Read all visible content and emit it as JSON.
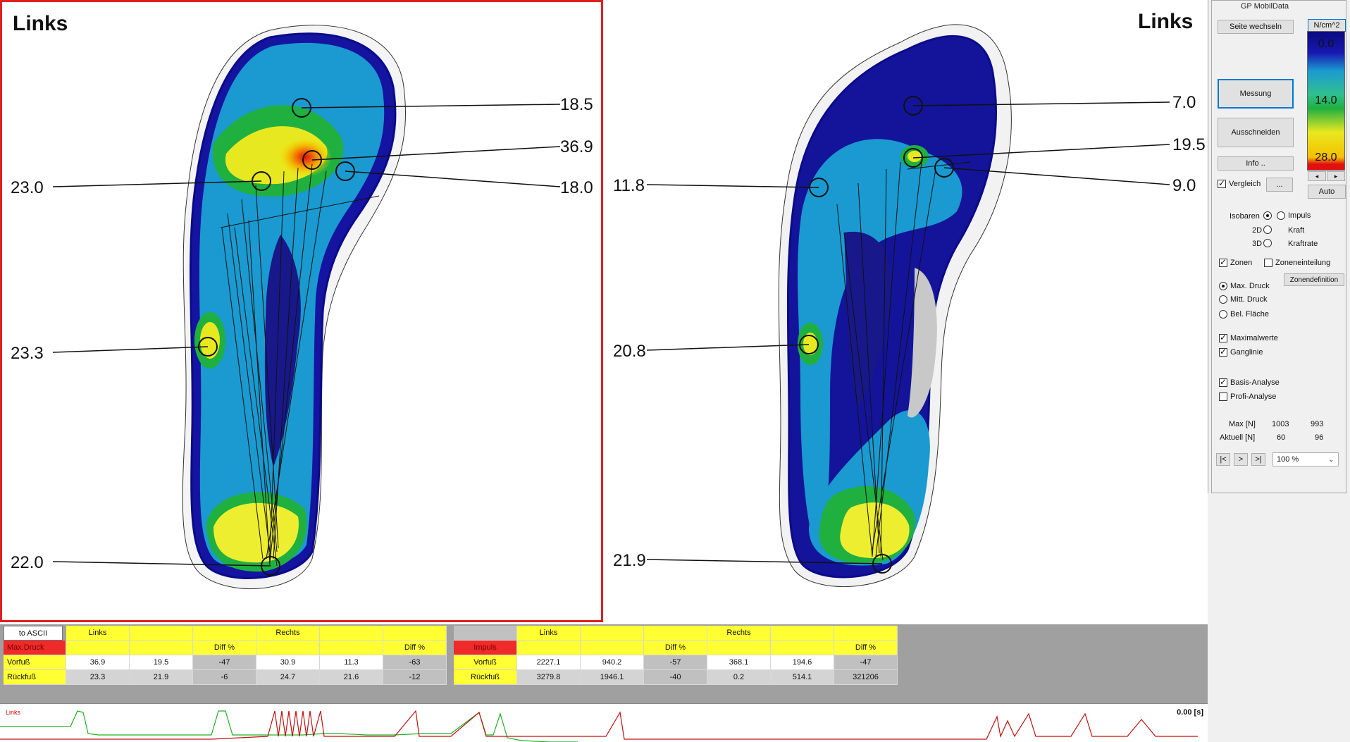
{
  "app_title": "GP MobilData",
  "panels": {
    "left": {
      "title": "Links",
      "labels": {
        "toe": "18.5",
        "meta1": "36.9",
        "meta5": "18.0",
        "medial": "23.0",
        "mid": "23.3",
        "heel": "22.0"
      }
    },
    "right": {
      "title": "Links",
      "labels": {
        "toe": "7.0",
        "meta1": "19.5",
        "meta5": "9.0",
        "medial": "11.8",
        "mid": "20.8",
        "heel": "21.9"
      }
    }
  },
  "controls": {
    "seite_wechseln": "Seite wechseln",
    "unit": "N/cm^2",
    "messung": "Messung",
    "ausschneiden": "Ausschneiden",
    "info": "Info ..",
    "vergleich": "Vergleich",
    "more": "...",
    "auto": "Auto",
    "scale_left_arrow": "◂",
    "scale_right_arrow": "▸",
    "scale": {
      "top": "0.0",
      "mid": "14.0",
      "bottom": "28.0"
    },
    "isobaren": "Isobaren",
    "impuls": "Impuls",
    "d2": "2D",
    "kraft": "Kraft",
    "d3": "3D",
    "kraftrate": "Kraftrate",
    "zonen": "Zonen",
    "zoneneinteilung": "Zoneneinteilung",
    "zonendefinition": "Zonendefinition",
    "max_druck": "Max. Druck",
    "mitt_druck": "Mitt. Druck",
    "bel_flaeche": "Bel. Fläche",
    "maximalwerte": "Maximalwerte",
    "ganglinie": "Ganglinie",
    "basis_analyse": "Basis-Analyse",
    "profi_analyse": "Profi-Analyse",
    "max_n_label": "Max [N]",
    "max_n_1": "1003",
    "max_n_2": "993",
    "aktuell_label": "Aktuell [N]",
    "aktuell_1": "60",
    "aktuell_2": "96",
    "nav_first": "|<",
    "nav_next": ">",
    "nav_last": ">|",
    "zoom": "100 %"
  },
  "table1": {
    "ascii_btn": "to ASCII",
    "header_links": "Links",
    "header_rechts": "Rechts",
    "metric": "Max.Druck",
    "diff": "Diff %",
    "rows": [
      {
        "label": "Vorfuß",
        "v1": "36.9",
        "v2": "19.5",
        "d1": "-47",
        "v3": "30.9",
        "v4": "11.3",
        "d2": "-63"
      },
      {
        "label": "Rückfuß",
        "v1": "23.3",
        "v2": "21.9",
        "d1": "-6",
        "v3": "24.7",
        "v4": "21.6",
        "d2": "-12"
      }
    ]
  },
  "table2": {
    "header_links": "Links",
    "header_rechts": "Rechts",
    "metric": "Impuls",
    "diff": "Diff %",
    "rows": [
      {
        "label": "Vorfuß",
        "v1": "2227.1",
        "v2": "940.2",
        "d1": "-57",
        "v3": "368.1",
        "v4": "194.6",
        "d2": "-47"
      },
      {
        "label": "Rückfuß",
        "v1": "3279.8",
        "v2": "1946.1",
        "d1": "-40",
        "v3": "0.2",
        "v4": "514.1",
        "d2": "321206"
      }
    ]
  },
  "timeline": {
    "label": "Links",
    "time": "0.00 [s]"
  },
  "colors": {
    "frame_red": "#e02020",
    "table_yellow": "#ffff33",
    "metric_red": "#ee2a2a"
  }
}
